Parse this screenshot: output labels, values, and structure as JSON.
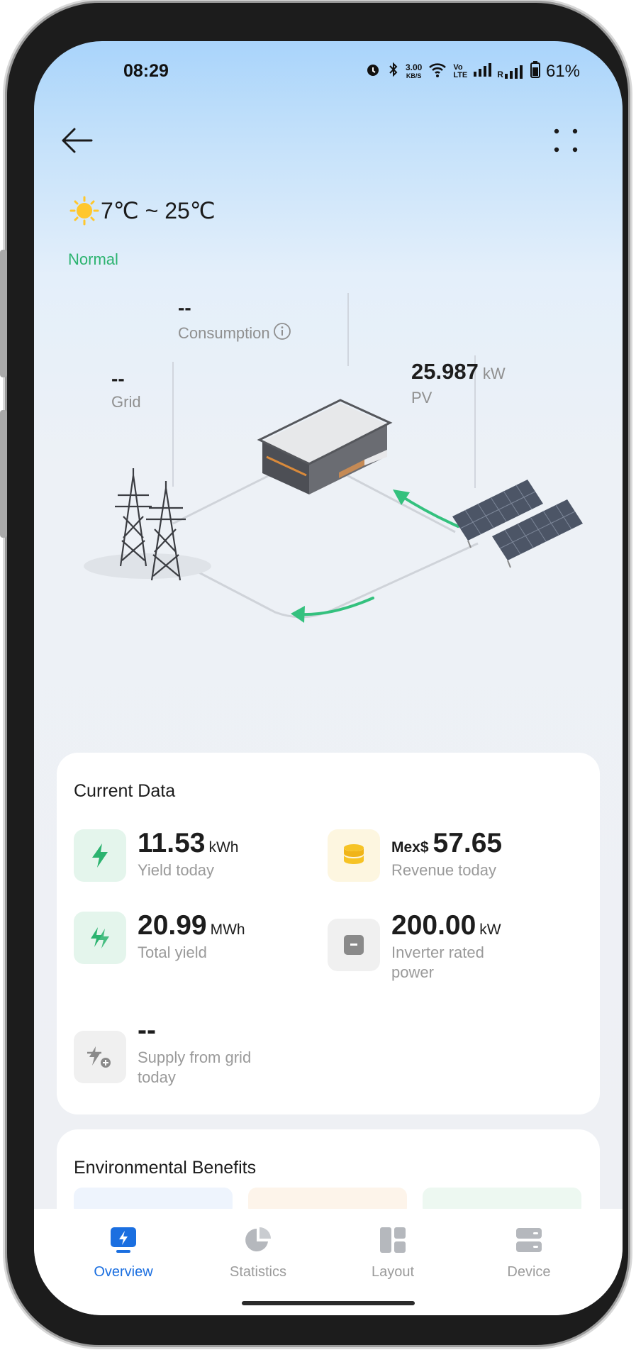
{
  "status_bar": {
    "time": "08:29",
    "net_speed_top": "3.00",
    "net_speed_bottom": "KB/S",
    "volte_top": "Vo",
    "volte_bottom": "LTE",
    "signal2_prefix": "R",
    "battery": "61%"
  },
  "weather": {
    "temperature_range": "7℃ ~ 25℃",
    "icon": "sun-icon"
  },
  "plant_status": "Normal",
  "flow": {
    "consumption": {
      "value": "--",
      "label": "Consumption"
    },
    "grid": {
      "value": "--",
      "label": "Grid"
    },
    "pv": {
      "value": "25.987",
      "unit": "kW",
      "label": "PV"
    }
  },
  "current_data": {
    "title": "Current Data",
    "yield_today": {
      "value": "11.53",
      "unit": "kWh",
      "label": "Yield today"
    },
    "revenue_today": {
      "prefix": "Mex$",
      "value": "57.65",
      "label": "Revenue today"
    },
    "total_yield": {
      "value": "20.99",
      "unit": "MWh",
      "label": "Total yield"
    },
    "inverter_rated_power": {
      "value": "200.00",
      "unit": "kW",
      "label": "Inverter rated power"
    },
    "supply_from_grid": {
      "value": "--",
      "label": "Supply from grid today"
    }
  },
  "environmental": {
    "title": "Environmental Benefits"
  },
  "tabs": [
    {
      "label": "Overview",
      "active": true
    },
    {
      "label": "Statistics",
      "active": false
    },
    {
      "label": "Layout",
      "active": false
    },
    {
      "label": "Device",
      "active": false
    }
  ],
  "colors": {
    "accent_green": "#2bb36f",
    "active_tab": "#1b6fe0",
    "revenue_yellow": "#f6c325"
  }
}
